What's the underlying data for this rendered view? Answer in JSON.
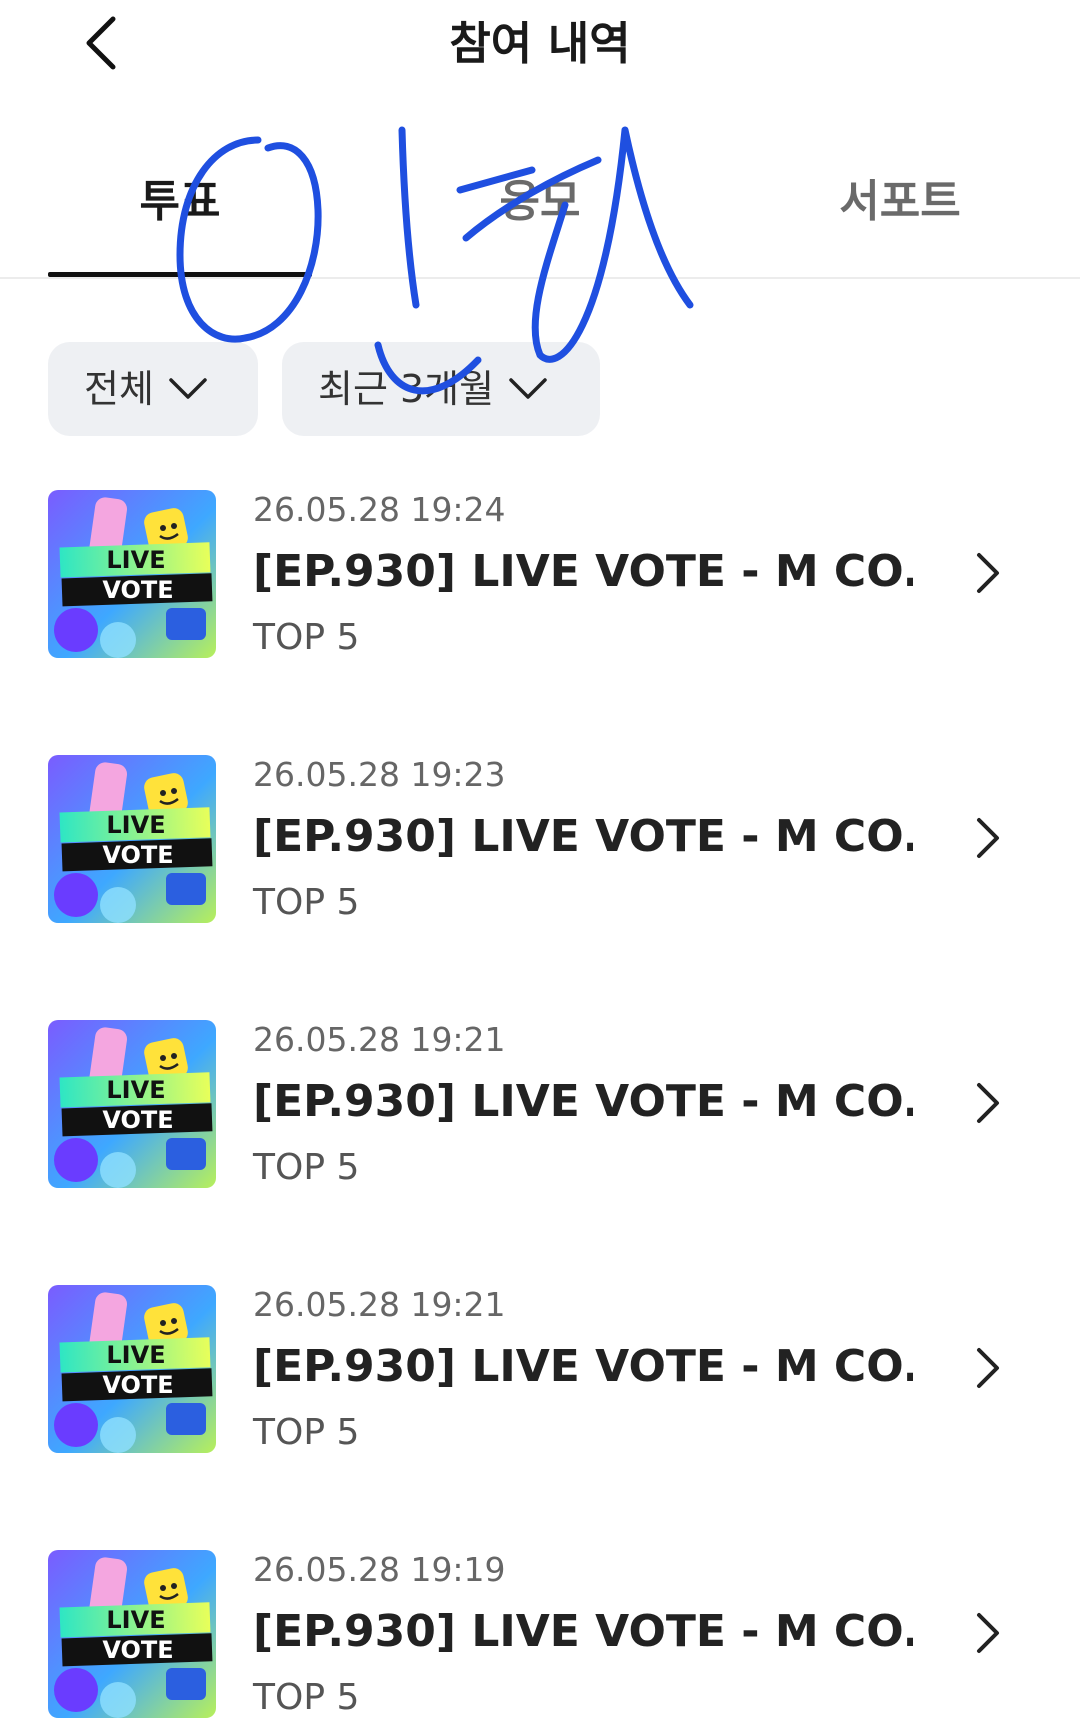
{
  "header": {
    "title": "참여 내역",
    "back_icon": "chevron-left-icon"
  },
  "tabs": [
    {
      "label": "투표",
      "selected": true
    },
    {
      "label": "응모",
      "selected": false
    },
    {
      "label": "서포트",
      "selected": false
    }
  ],
  "filters": {
    "category": {
      "label": "전체",
      "icon": "chevron-down-icon"
    },
    "period": {
      "label": "최근 3개월",
      "icon": "chevron-down-icon"
    }
  },
  "thumbnail": {
    "line1": "LIVE",
    "line2": "VOTE"
  },
  "items": [
    {
      "date": "26.05.28 19:24",
      "title": "[EP.930] LIVE VOTE - M CO...",
      "subtitle": "TOP 5"
    },
    {
      "date": "26.05.28 19:23",
      "title": "[EP.930] LIVE VOTE - M CO...",
      "subtitle": "TOP 5"
    },
    {
      "date": "26.05.28 19:21",
      "title": "[EP.930] LIVE VOTE - M CO...",
      "subtitle": "TOP 5"
    },
    {
      "date": "26.05.28 19:21",
      "title": "[EP.930] LIVE VOTE - M CO...",
      "subtitle": "TOP 5"
    },
    {
      "date": "26.05.28 19:19",
      "title": "[EP.930] LIVE VOTE - M CO...",
      "subtitle": "TOP 5"
    }
  ],
  "colors": {
    "annotation_ink": "#1f4fe0",
    "tab_active": "#1a1a1a",
    "tab_inactive": "#6a6a6a",
    "filter_bg": "#eef0f3"
  }
}
